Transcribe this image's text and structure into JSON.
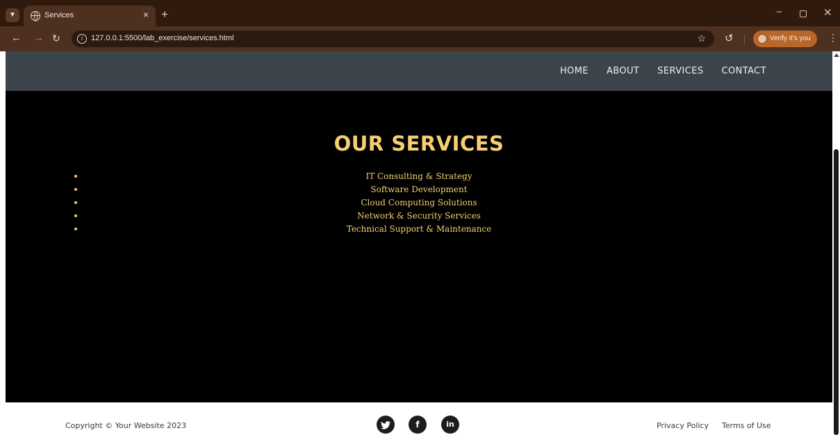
{
  "browser": {
    "tab_title": "Services",
    "tab_close": "×",
    "new_tab": "+",
    "url": "127.0.0.1:5500/lab_exercise/services.html",
    "profile_label": "Verify it's you",
    "icons": {
      "tab_search": "chevron-down-icon",
      "favicon": "globe-icon",
      "back": "arrow-left-icon",
      "forward": "arrow-right-icon",
      "reload": "reload-icon",
      "site_info": "info-icon",
      "bookmark": "star-icon",
      "history": "history-icon",
      "menu": "more-vertical-icon",
      "minimize": "minimize-icon",
      "maximize": "restore-icon",
      "close": "close-icon"
    }
  },
  "site": {
    "nav": [
      "HOME",
      "ABOUT",
      "SERVICES",
      "CONTACT"
    ],
    "services_title": "OUR SERVICES",
    "services": [
      "IT Consulting & Strategy",
      "Software Development",
      "Cloud Computing Solutions",
      "Network & Security Services",
      "Technical Support & Maintenance"
    ],
    "footer": {
      "copyright": "Copyright © Your Website 2023",
      "social": [
        {
          "name": "twitter-icon",
          "glyph": "🐦"
        },
        {
          "name": "facebook-icon",
          "glyph": "f"
        },
        {
          "name": "linkedin-icon",
          "glyph": "in"
        }
      ],
      "links": [
        "Privacy Policy",
        "Terms of Use"
      ]
    }
  },
  "colors": {
    "header_bg": "#3c434b",
    "services_bg": "#000000",
    "accent": "#f6cf75",
    "browser_frame": "#2f1a0d",
    "profile_pill": "#b8662a"
  }
}
